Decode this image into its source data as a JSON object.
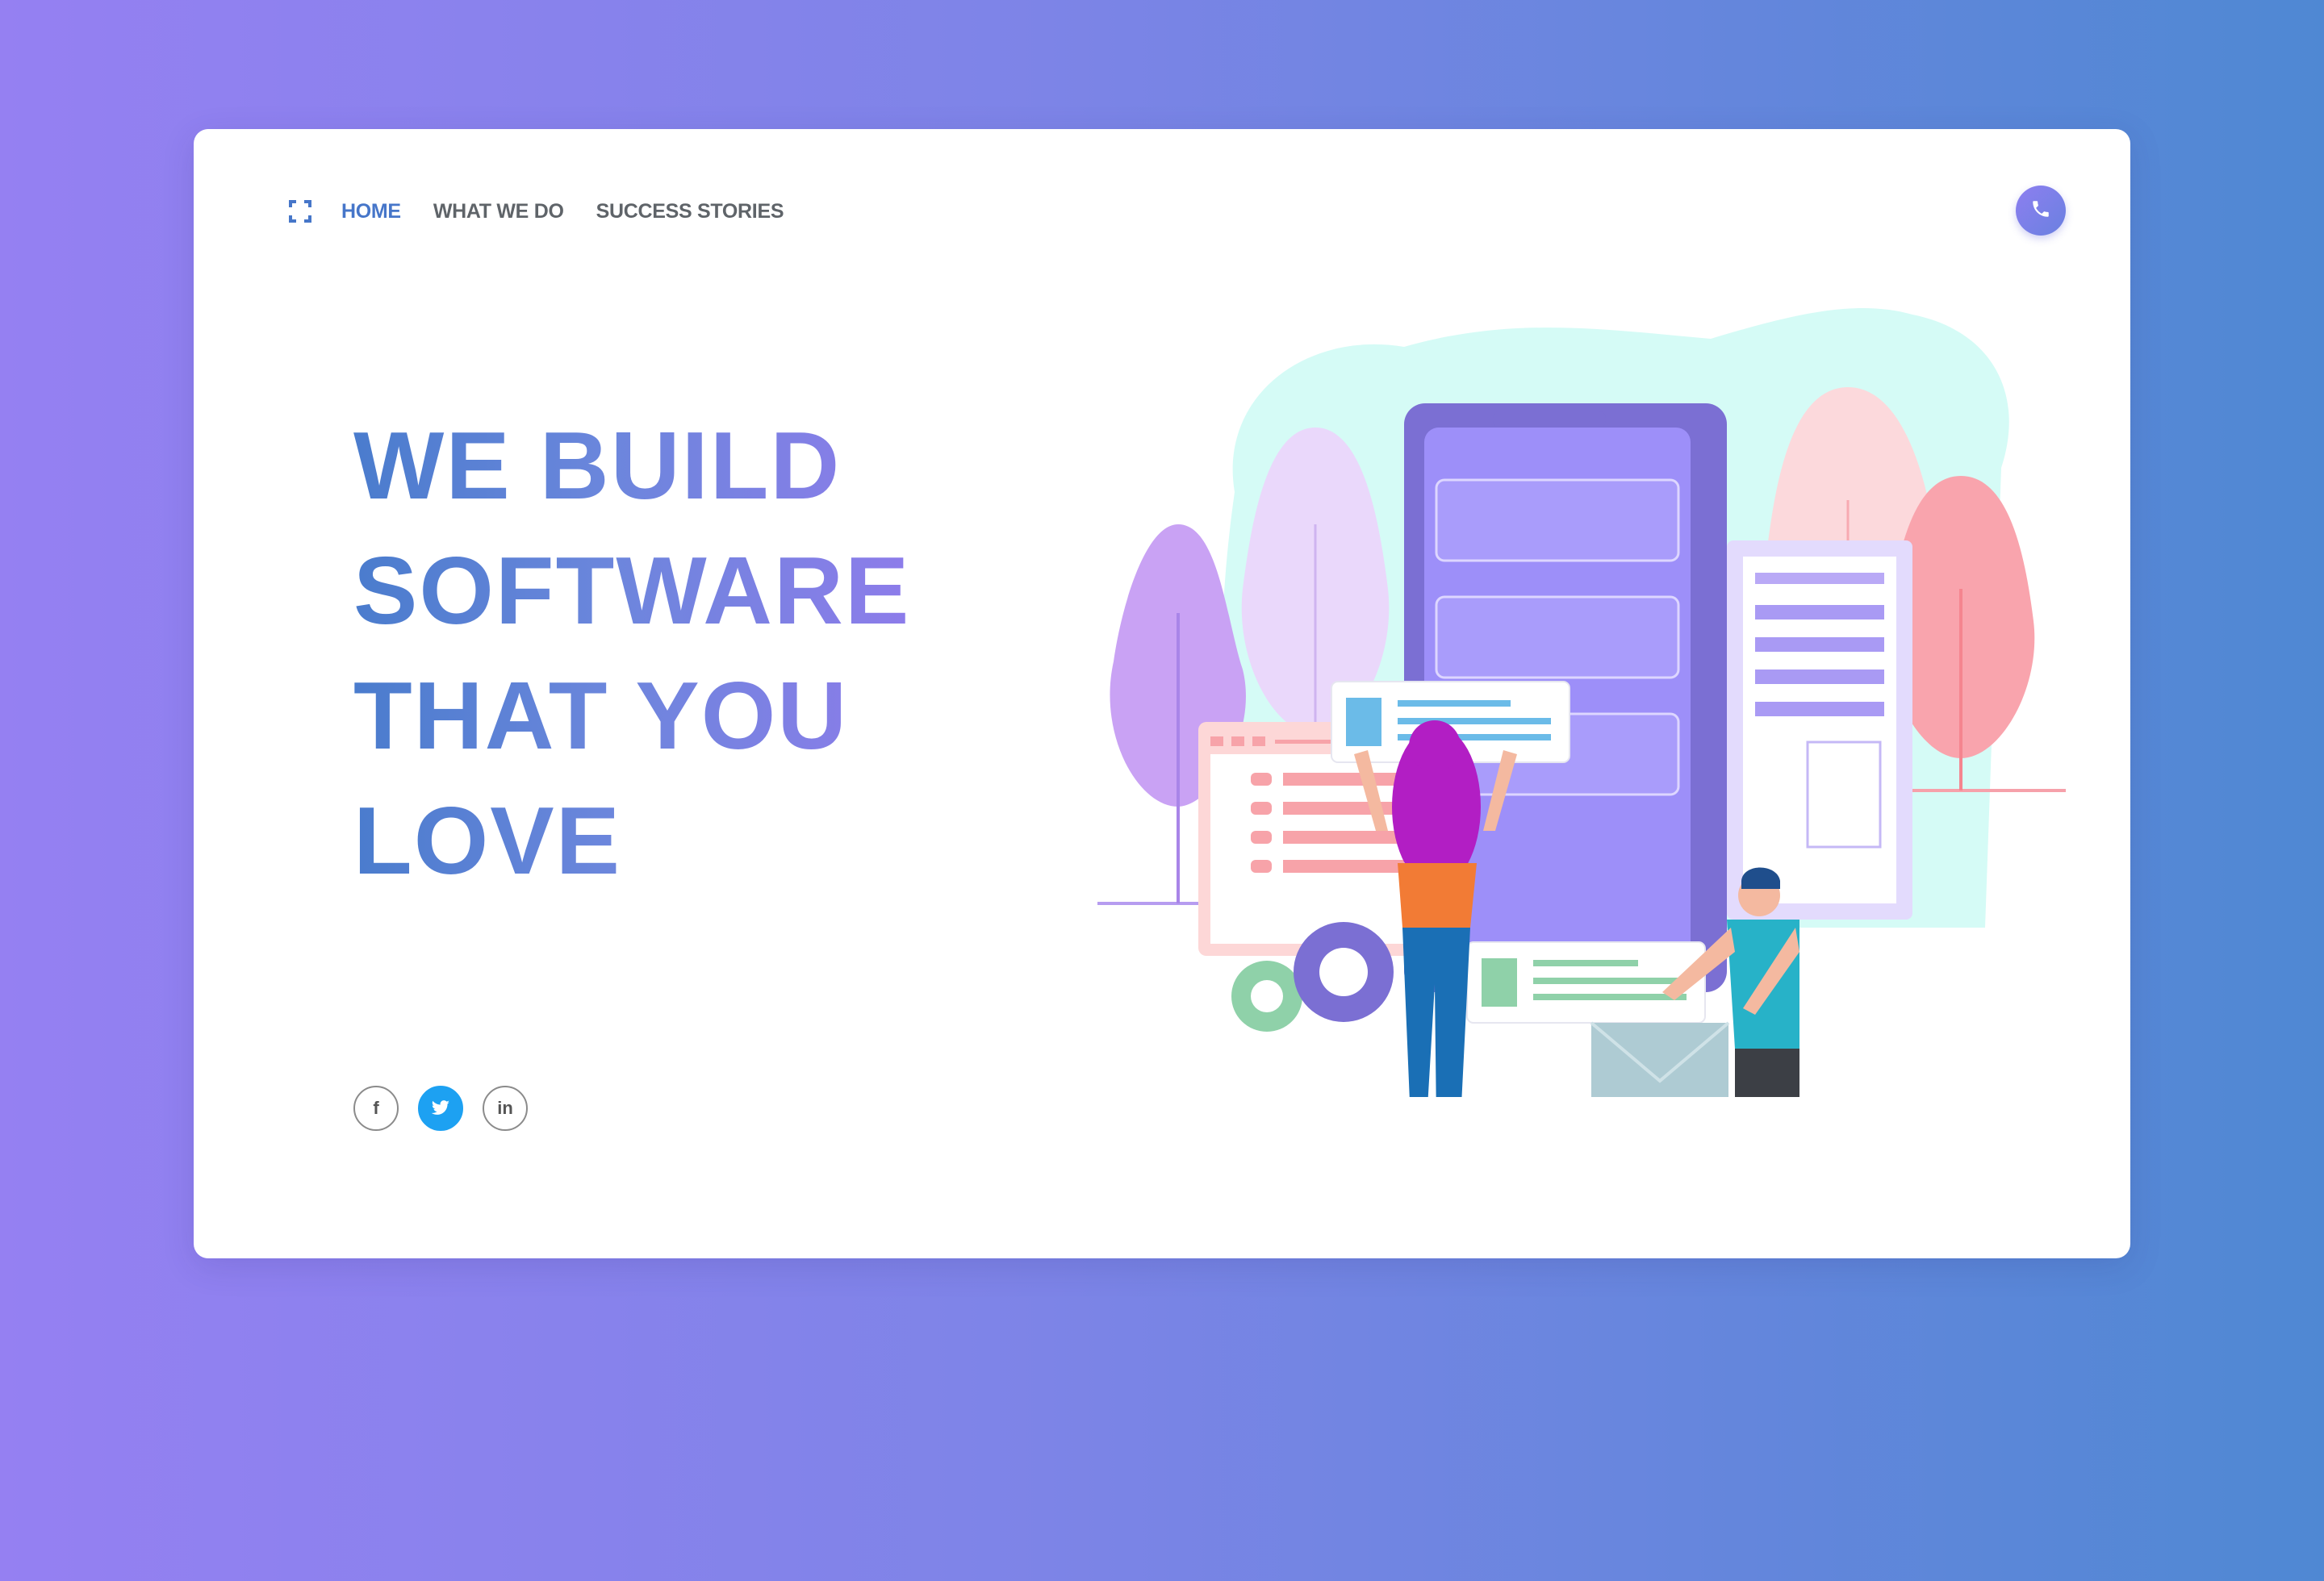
{
  "nav": {
    "logo_icon": "expand-corners-icon",
    "items": [
      {
        "label": "HOME",
        "active": true
      },
      {
        "label": "WHAT WE DO",
        "active": false
      },
      {
        "label": "SUCCESS STORIES",
        "active": false
      }
    ],
    "phone_icon": "phone-icon"
  },
  "hero": {
    "lines": [
      "WE BUILD",
      "SOFTWARE",
      "THAT YOU",
      "LOVE"
    ]
  },
  "social": [
    {
      "icon": "facebook-icon",
      "glyph": "f"
    },
    {
      "icon": "twitter-icon",
      "glyph": ""
    },
    {
      "icon": "linkedin-icon",
      "glyph": "in"
    }
  ],
  "colors": {
    "accent": "#4676c9",
    "phone_button": "#7f80ea",
    "twitter": "#1da1f2",
    "background_start": "#9580f2",
    "background_end": "#4f88d3"
  }
}
